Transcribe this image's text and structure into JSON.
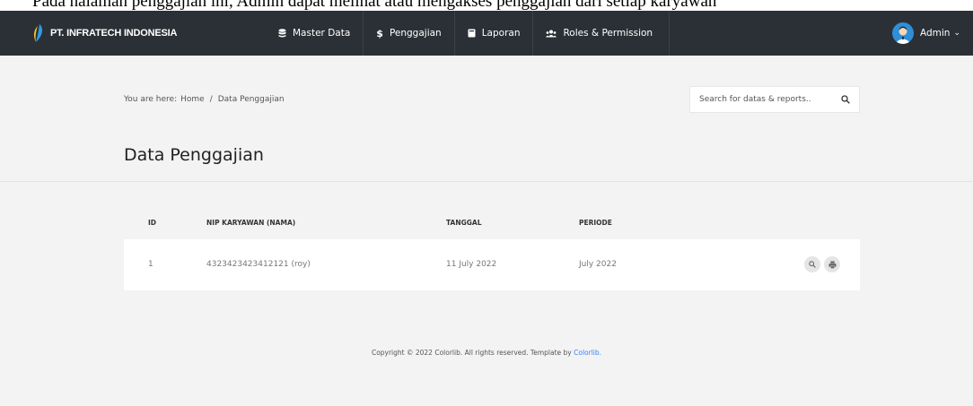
{
  "caption": "Pada halaman penggajian ini, Admin dapat melihat atau mengakses penggajian dari setiap karyawan",
  "navbar": {
    "brand": "PT. INFRATECH INDONESIA",
    "items": [
      {
        "label": "Master Data",
        "icon": "database-icon"
      },
      {
        "label": "Penggajian",
        "icon": "dollar-icon"
      },
      {
        "label": "Laporan",
        "icon": "book-icon"
      },
      {
        "label": "Roles & Permission",
        "icon": "users-icon"
      }
    ],
    "user": {
      "label": "Admin"
    }
  },
  "breadcrumb": {
    "prefix": "You are here:",
    "home": "Home",
    "separator": "/",
    "current": "Data Penggajian"
  },
  "search": {
    "placeholder": "Search for datas & reports.."
  },
  "page": {
    "title": "Data Penggajian"
  },
  "table": {
    "headers": {
      "id": "ID",
      "nip": "NIP KARYAWAN (NAMA)",
      "tanggal": "TANGGAL",
      "periode": "PERIODE"
    },
    "rows": [
      {
        "id": "1",
        "nip": "4323423423412121 (roy)",
        "tanggal": "11 July 2022",
        "periode": "July 2022"
      }
    ]
  },
  "footer": {
    "text": "Copyright © 2022 Colorlib. All rights reserved. Template by",
    "link": "Colorlib."
  },
  "colors": {
    "navbar": "#2b3036",
    "background": "#f3f3f4",
    "link": "#3b82f6",
    "avatar": "#2f8fd6"
  }
}
